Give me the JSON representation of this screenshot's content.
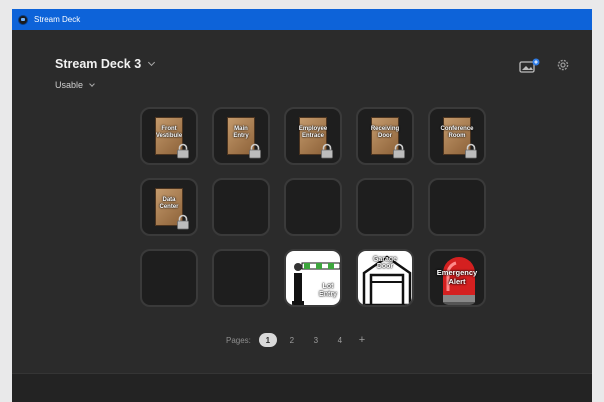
{
  "window": {
    "title": "Stream Deck"
  },
  "header": {
    "device_name": "Stream Deck 3",
    "profile": "Usable",
    "image_icon": "image-with-badge-icon",
    "settings_icon": "gear-icon"
  },
  "keys": [
    {
      "type": "door",
      "label": "Front\nVestibule"
    },
    {
      "type": "door",
      "label": "Main\nEntry"
    },
    {
      "type": "door",
      "label": "Employee\nEntrace"
    },
    {
      "type": "door",
      "label": "Receiving\nDoor"
    },
    {
      "type": "door",
      "label": "Conference\nRoom"
    },
    {
      "type": "door",
      "label": "Data\nCenter"
    },
    {
      "type": "empty"
    },
    {
      "type": "empty"
    },
    {
      "type": "empty"
    },
    {
      "type": "empty"
    },
    {
      "type": "empty"
    },
    {
      "type": "empty"
    },
    {
      "type": "gate",
      "label": "Lot\nEntry"
    },
    {
      "type": "garage",
      "label": "Garage\nDoor"
    },
    {
      "type": "alert",
      "label": "Emergency\nAlert"
    }
  ],
  "pages": {
    "label": "Pages:",
    "items": [
      "1",
      "2",
      "3",
      "4"
    ],
    "active": "1",
    "add_label": "+"
  },
  "colors": {
    "titlebar": "#0d63d9",
    "background": "#2b2b2b",
    "key_border": "#3a3a3a",
    "alert_red": "#d42020",
    "gate_green": "#3da63d"
  }
}
